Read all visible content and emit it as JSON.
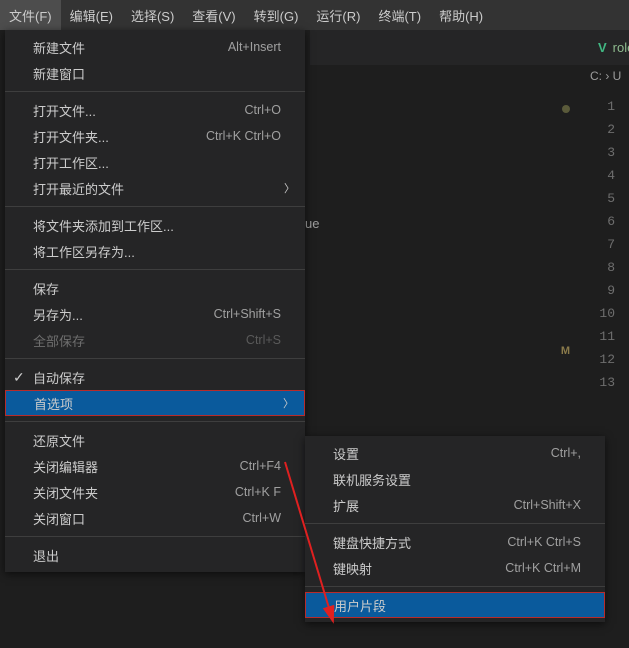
{
  "menubar": {
    "items": [
      {
        "label": "文件(F)",
        "active": true
      },
      {
        "label": "编辑(E)"
      },
      {
        "label": "选择(S)"
      },
      {
        "label": "查看(V)"
      },
      {
        "label": "转到(G)"
      },
      {
        "label": "运行(R)"
      },
      {
        "label": "终端(T)"
      },
      {
        "label": "帮助(H)"
      }
    ]
  },
  "fileMenu": {
    "groups": [
      [
        {
          "label": "新建文件",
          "shortcut": "Alt+Insert"
        },
        {
          "label": "新建窗口",
          "shortcut": ""
        }
      ],
      [
        {
          "label": "打开文件...",
          "shortcut": "Ctrl+O"
        },
        {
          "label": "打开文件夹...",
          "shortcut": "Ctrl+K Ctrl+O"
        },
        {
          "label": "打开工作区...",
          "shortcut": ""
        },
        {
          "label": "打开最近的文件",
          "shortcut": "",
          "submenu": true
        }
      ],
      [
        {
          "label": "将文件夹添加到工作区...",
          "shortcut": ""
        },
        {
          "label": "将工作区另存为...",
          "shortcut": ""
        }
      ],
      [
        {
          "label": "保存",
          "shortcut": ""
        },
        {
          "label": "另存为...",
          "shortcut": "Ctrl+Shift+S"
        },
        {
          "label": "全部保存",
          "shortcut": "Ctrl+S",
          "disabled": true
        }
      ],
      [
        {
          "label": "自动保存",
          "shortcut": "",
          "checked": true
        },
        {
          "label": "首选项",
          "shortcut": "",
          "submenu": true,
          "selected": true
        }
      ],
      [
        {
          "label": "还原文件",
          "shortcut": ""
        },
        {
          "label": "关闭编辑器",
          "shortcut": "Ctrl+F4"
        },
        {
          "label": "关闭文件夹",
          "shortcut": "Ctrl+K F"
        },
        {
          "label": "关闭窗口",
          "shortcut": "Ctrl+W"
        }
      ],
      [
        {
          "label": "退出",
          "shortcut": ""
        }
      ]
    ]
  },
  "prefSubMenu": {
    "groups": [
      [
        {
          "label": "设置",
          "shortcut": "Ctrl+,"
        },
        {
          "label": "联机服务设置",
          "shortcut": ""
        },
        {
          "label": "扩展",
          "shortcut": "Ctrl+Shift+X"
        }
      ],
      [
        {
          "label": "键盘快捷方式",
          "shortcut": "Ctrl+K Ctrl+S"
        },
        {
          "label": "键映射",
          "shortcut": "Ctrl+K Ctrl+M"
        }
      ],
      [
        {
          "label": "用户片段",
          "shortcut": "",
          "selected": true
        }
      ]
    ]
  },
  "tab": {
    "icon": "V",
    "name": "role"
  },
  "breadcrumb": {
    "seg1": "C:",
    "seg2": "U"
  },
  "lineNumbers": [
    1,
    2,
    3,
    4,
    5,
    6,
    7,
    8,
    9,
    10,
    11,
    12,
    13
  ],
  "minimapMarker": "M",
  "fragment": "ue"
}
